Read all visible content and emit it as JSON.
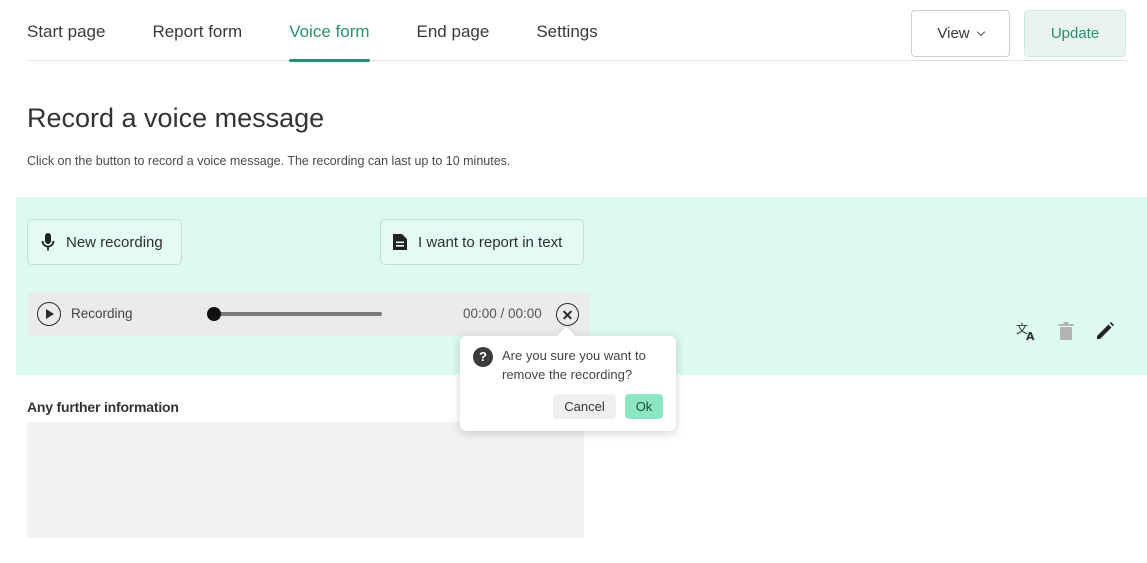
{
  "nav": {
    "tabs": [
      {
        "label": "Start page"
      },
      {
        "label": "Report form"
      },
      {
        "label": "Voice form"
      },
      {
        "label": "End page"
      },
      {
        "label": "Settings"
      }
    ],
    "active_tab": "Voice form",
    "view_label": "View",
    "update_label": "Update"
  },
  "heading": {
    "title": "Record a voice message",
    "description": "Click on the button to record a voice message. The recording can last up to 10 minutes."
  },
  "voice_panel": {
    "new_recording_label": "New recording",
    "text_report_label": "I want to report in text",
    "player": {
      "label": "Recording",
      "time": "00:00 / 00:00",
      "progress": 0
    },
    "tools": [
      "translate-icon",
      "trash-icon",
      "pencil-icon"
    ]
  },
  "further_info": {
    "label": "Any further information",
    "value": ""
  },
  "confirm_popover": {
    "message": "Are you sure you want to remove the recording?",
    "cancel_label": "Cancel",
    "ok_label": "Ok"
  },
  "colors": {
    "accent": "#2a8f74",
    "panel_bg": "#ddfaf0",
    "ok_button": "#8ce6c3"
  }
}
